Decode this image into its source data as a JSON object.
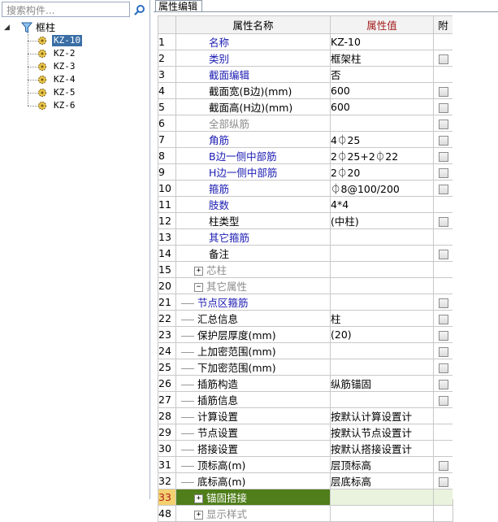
{
  "search": {
    "placeholder": "搜索构件..."
  },
  "tree": {
    "root_label": "框柱",
    "items": [
      "KZ-10",
      "KZ-2",
      "KZ-3",
      "KZ-4",
      "KZ-5",
      "KZ-6"
    ],
    "selected": "KZ-10"
  },
  "panel": {
    "tab_label": "属性编辑",
    "header": {
      "num": "",
      "name": "属性名称",
      "value": "属性值",
      "attach": "附"
    }
  },
  "rows": [
    {
      "num": "1",
      "name": "名称",
      "value": "KZ-10",
      "style": "blue",
      "check": false
    },
    {
      "num": "2",
      "name": "类别",
      "value": "框架柱",
      "style": "blue",
      "check": true
    },
    {
      "num": "3",
      "name": "截面编辑",
      "value": "否",
      "style": "blue",
      "check": false
    },
    {
      "num": "4",
      "name": "截面宽(B边)(mm)",
      "value": "600",
      "style": "black",
      "check": true
    },
    {
      "num": "5",
      "name": "截面高(H边)(mm)",
      "value": "600",
      "style": "black",
      "check": true
    },
    {
      "num": "6",
      "name": "全部纵筋",
      "value": "",
      "style": "gray",
      "check": true
    },
    {
      "num": "7",
      "name": "角筋",
      "value": "4⏀25",
      "style": "blue",
      "check": true
    },
    {
      "num": "8",
      "name": "B边一侧中部筋",
      "value": "2⏀25+2⏀22",
      "style": "blue",
      "check": true
    },
    {
      "num": "9",
      "name": "H边一侧中部筋",
      "value": "2⏀20",
      "style": "blue",
      "check": true
    },
    {
      "num": "10",
      "name": "箍筋",
      "value": "⏀8@100/200",
      "style": "blue",
      "check": true
    },
    {
      "num": "11",
      "name": "肢数",
      "value": "4*4",
      "style": "blue",
      "check": false
    },
    {
      "num": "12",
      "name": "柱类型",
      "value": "(中柱)",
      "style": "black",
      "check": true
    },
    {
      "num": "13",
      "name": "其它箍筋",
      "value": "",
      "style": "blue",
      "check": false
    },
    {
      "num": "14",
      "name": "备注",
      "value": "",
      "style": "black",
      "check": true
    },
    {
      "num": "15",
      "name": "芯柱",
      "value": "",
      "style": "gray",
      "check": false,
      "expander": "+"
    },
    {
      "num": "20",
      "name": "其它属性",
      "value": "",
      "style": "gray",
      "check": false,
      "expander": "−"
    },
    {
      "num": "21",
      "name": "节点区箍筋",
      "value": "",
      "style": "blue",
      "check": true,
      "indent": true
    },
    {
      "num": "22",
      "name": "汇总信息",
      "value": "柱",
      "style": "black",
      "check": true,
      "indent": true
    },
    {
      "num": "23",
      "name": "保护层厚度(mm)",
      "value": "(20)",
      "style": "black",
      "check": true,
      "indent": true
    },
    {
      "num": "24",
      "name": "上加密范围(mm)",
      "value": "",
      "style": "black",
      "check": true,
      "indent": true
    },
    {
      "num": "25",
      "name": "下加密范围(mm)",
      "value": "",
      "style": "black",
      "check": true,
      "indent": true
    },
    {
      "num": "26",
      "name": "插筋构造",
      "value": "纵筋锚固",
      "style": "black",
      "check": true,
      "indent": true
    },
    {
      "num": "27",
      "name": "插筋信息",
      "value": "",
      "style": "black",
      "check": true,
      "indent": true
    },
    {
      "num": "28",
      "name": "计算设置",
      "value": "按默认计算设置计",
      "style": "black",
      "check": false,
      "indent": true
    },
    {
      "num": "29",
      "name": "节点设置",
      "value": "按默认节点设置计",
      "style": "black",
      "check": false,
      "indent": true
    },
    {
      "num": "30",
      "name": "搭接设置",
      "value": "按默认搭接设置计",
      "style": "black",
      "check": false,
      "indent": true
    },
    {
      "num": "31",
      "name": "顶标高(m)",
      "value": "层顶标高",
      "style": "black",
      "check": true,
      "indent": true
    },
    {
      "num": "32",
      "name": "底标高(m)",
      "value": "层底标高",
      "style": "black",
      "check": true,
      "indent": true
    },
    {
      "num": "33",
      "name": "锚固搭接",
      "value": "",
      "style": "selected",
      "check": false,
      "expander": "+"
    },
    {
      "num": "48",
      "name": "显示样式",
      "value": "",
      "style": "gray",
      "check": false,
      "expander": "+"
    }
  ],
  "icons": {
    "search": "magnifier-icon",
    "filter": "funnel-icon",
    "component": "gear-icon"
  },
  "colors": {
    "selection": "#3a6ea5",
    "header_value": "#f7c472",
    "selected_row": "#4f7e1a",
    "blue_text": "#1a1ab3"
  }
}
